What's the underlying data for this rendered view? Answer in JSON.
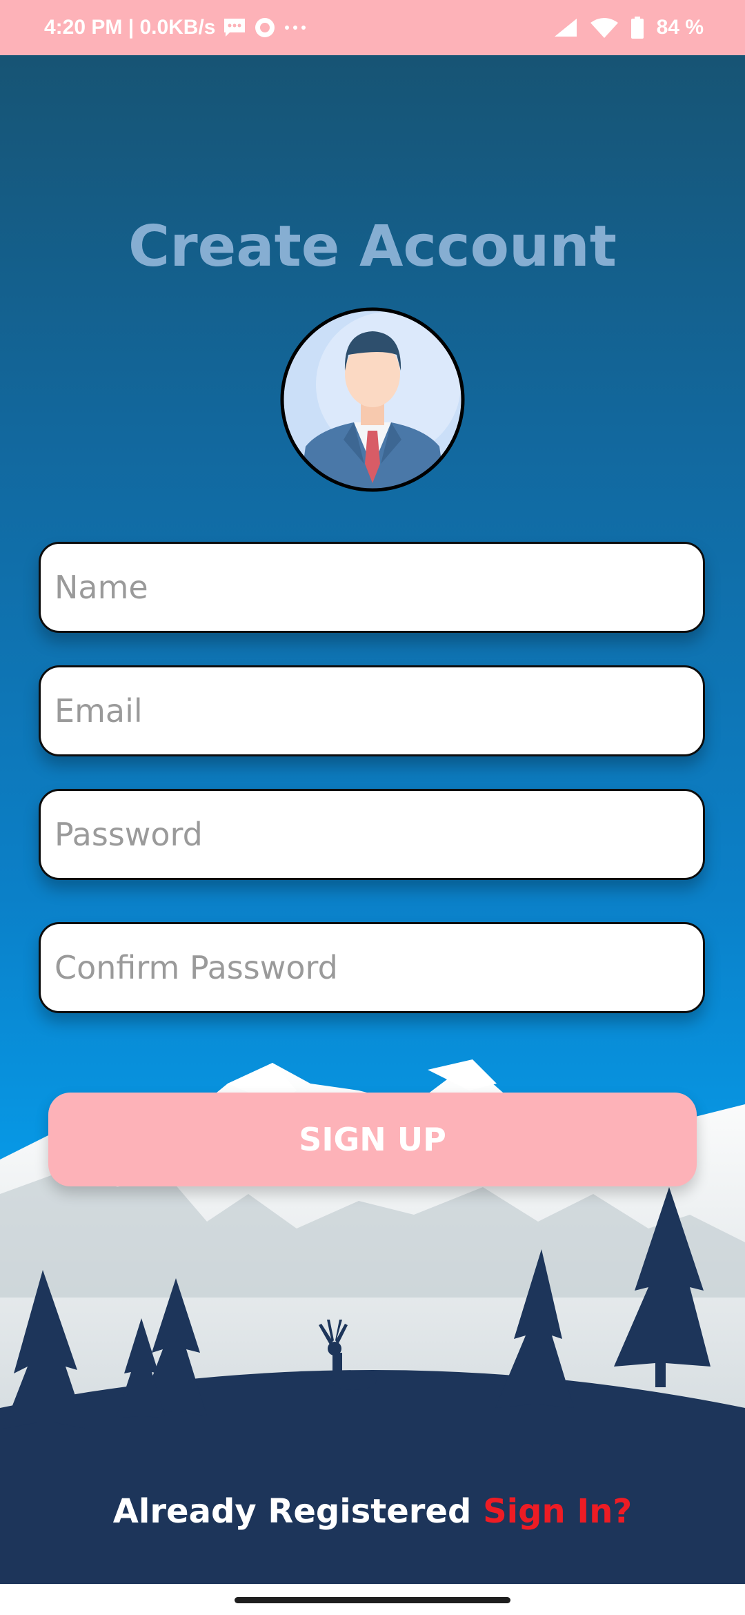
{
  "status_bar": {
    "time_info": "4:20 PM | 0.0KB/s",
    "battery": "84 %",
    "icons": [
      "message-icon",
      "record-icon",
      "more-dots-icon",
      "signal-icon",
      "wifi-icon",
      "battery-icon"
    ]
  },
  "page": {
    "title": "Create Account",
    "avatar_icon": "user-avatar-icon"
  },
  "form": {
    "name_placeholder": "Name",
    "email_placeholder": "Email",
    "password_placeholder": "Password",
    "confirm_password_placeholder": "Confirm Password",
    "signup_label": "SIGN UP"
  },
  "footer": {
    "prompt": "Already Registered ",
    "signin_link": "Sign In?"
  },
  "colors": {
    "status_bar": "#fdb2b8",
    "button": "#fdb2b8",
    "title": "#86aed2",
    "hill": "#1d355a",
    "signin_link": "#ee1c24"
  }
}
